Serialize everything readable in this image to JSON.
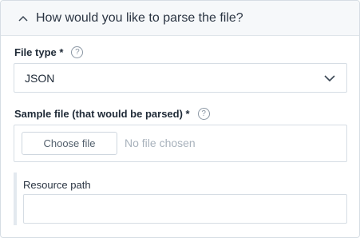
{
  "section": {
    "title": "How would you like to parse the file?"
  },
  "file_type": {
    "label": "File type *",
    "help": "?",
    "value": "JSON"
  },
  "sample_file": {
    "label": "Sample file (that would be parsed) *",
    "help": "?",
    "button_label": "Choose file",
    "status": "No file chosen"
  },
  "resource_path": {
    "label": "Resource path",
    "value": ""
  },
  "icons": {
    "collapse": "chevron-up-icon",
    "dropdown": "chevron-down-icon",
    "help": "question-circle-icon"
  }
}
